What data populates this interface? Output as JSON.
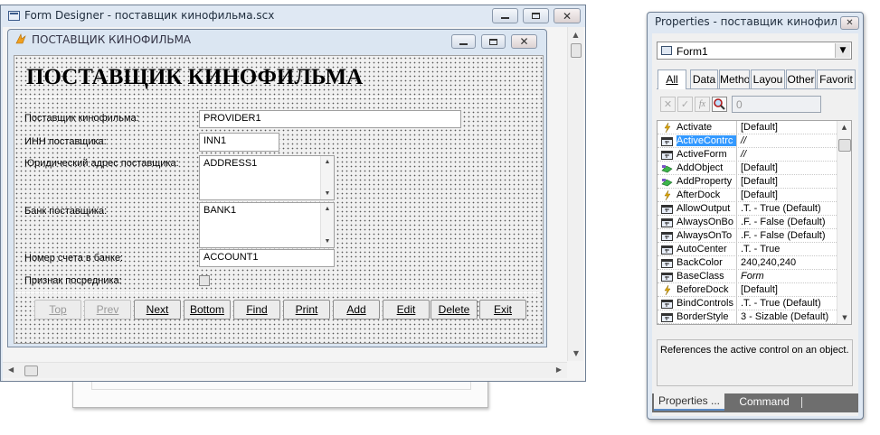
{
  "designer": {
    "title": "Form Designer - поставщик кинофильма.scx",
    "inner_title": "ПОСТАВЩИК КИНОФИЛЬМА",
    "heading": "ПОСТАВЩИК КИНОФИЛЬМА",
    "labels": {
      "provider": "Поставщик кинофильма:",
      "inn": "ИНН поставщика:",
      "address": "Юридический адрес поставщика:",
      "bank": "Банк поставщика:",
      "account": "Номер счета в банке:",
      "agent": "Признак посредника:"
    },
    "fields": {
      "provider": "PROVIDER1",
      "inn": "INN1",
      "address": "ADDRESS1",
      "bank": "BANK1",
      "account": "ACCOUNT1"
    },
    "nav_buttons": [
      "Top",
      "Prev",
      "Next",
      "Bottom",
      "Find",
      "Print",
      "Add",
      "Edit",
      "Delete",
      "Exit"
    ]
  },
  "properties": {
    "title": "Properties - поставщик кинофильма.scx",
    "object_selector": "Form1",
    "tabs": [
      "All",
      "Data",
      "Metho",
      "Layou",
      "Other",
      "Favorit"
    ],
    "value_box": "0",
    "rows": [
      {
        "name": "Activate",
        "value": "[Default]",
        "icon": "event"
      },
      {
        "name": "ActiveContrc",
        "value": "//",
        "icon": "prop"
      },
      {
        "name": "ActiveForm",
        "value": "//",
        "icon": "prop"
      },
      {
        "name": "AddObject",
        "value": "[Default]",
        "icon": "method"
      },
      {
        "name": "AddProperty",
        "value": "[Default]",
        "icon": "method"
      },
      {
        "name": "AfterDock",
        "value": "[Default]",
        "icon": "event"
      },
      {
        "name": "AllowOutput",
        "value": ".T. - True (Default)",
        "icon": "prop"
      },
      {
        "name": "AlwaysOnBo",
        "value": ".F. - False (Default)",
        "icon": "prop"
      },
      {
        "name": "AlwaysOnTo",
        "value": ".F. - False (Default)",
        "icon": "prop"
      },
      {
        "name": "AutoCenter",
        "value": ".T. - True",
        "icon": "prop"
      },
      {
        "name": "BackColor",
        "value": "240,240,240",
        "icon": "prop"
      },
      {
        "name": "BaseClass",
        "value": "Form",
        "icon": "prop"
      },
      {
        "name": "BeforeDock",
        "value": "[Default]",
        "icon": "event"
      },
      {
        "name": "BindControls",
        "value": ".T. - True (Default)",
        "icon": "prop"
      },
      {
        "name": "BorderStyle",
        "value": "3 - Sizable (Default)",
        "icon": "prop"
      }
    ],
    "selected_index": 1,
    "description": "References the active control on an object.",
    "bottom_tabs": [
      "Properties ...",
      "Command"
    ]
  }
}
